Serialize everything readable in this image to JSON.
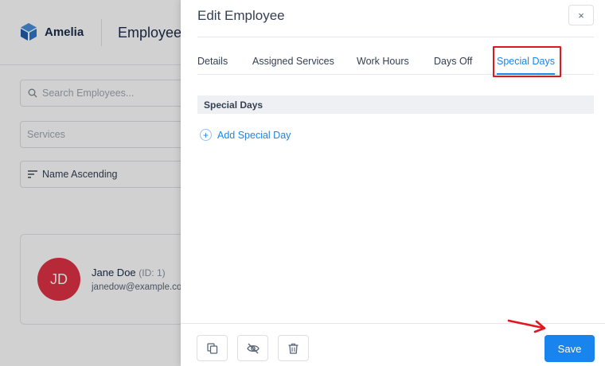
{
  "background": {
    "brand_name": "Amelia",
    "page_title": "Employees",
    "search_placeholder": "Search Employees...",
    "services_placeholder": "Services",
    "sort_label": "Name Ascending",
    "employee": {
      "initials": "JD",
      "name": "Jane Doe",
      "id_label": "(ID: 1)",
      "email": "janedow@example.com"
    }
  },
  "dialog": {
    "title": "Edit Employee",
    "close_glyph": "×",
    "tabs": [
      {
        "label": "Details"
      },
      {
        "label": "Assigned Services"
      },
      {
        "label": "Work Hours"
      },
      {
        "label": "Days Off"
      },
      {
        "label": "Special Days",
        "active": true
      }
    ],
    "section_title": "Special Days",
    "add_label": "Add Special Day",
    "add_glyph": "+",
    "save_label": "Save"
  },
  "colors": {
    "accent": "#1a84ee",
    "avatar": "#e03345",
    "highlight": "#e2161e"
  },
  "icons": [
    "search-icon",
    "sort-icon",
    "close-icon",
    "plus-circle-icon",
    "duplicate-icon",
    "hide-icon",
    "trash-icon",
    "arrow-annotation-icon"
  ]
}
